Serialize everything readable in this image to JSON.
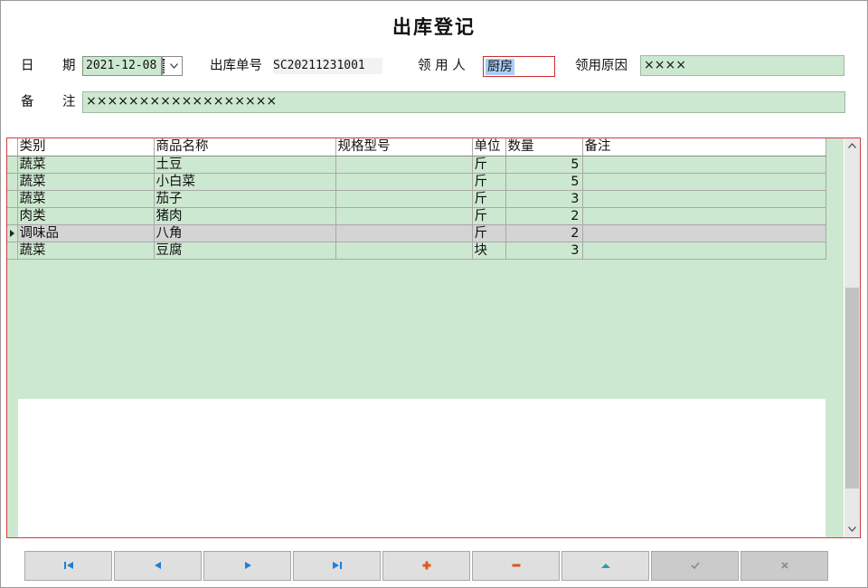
{
  "window": {
    "title": "出库登记"
  },
  "form": {
    "date_label_1": "日",
    "date_label_2": "期",
    "date_value": "2021-12-08",
    "order_label": "出库单号",
    "order_value": "SC20211231001",
    "receiver_label": "领 用 人",
    "receiver_value": "厨房",
    "reason_label": "领用原因",
    "reason_value": "××××",
    "remark_label_1": "备",
    "remark_label_2": "注",
    "remark_value": "××××××××××××××××××"
  },
  "grid": {
    "columns": [
      "类别",
      "商品名称",
      "规格型号",
      "单位",
      "数量",
      "备注"
    ],
    "rows": [
      {
        "category": "蔬菜",
        "name": "土豆",
        "spec": "",
        "unit": "斤",
        "qty": "5",
        "note": ""
      },
      {
        "category": "蔬菜",
        "name": "小白菜",
        "spec": "",
        "unit": "斤",
        "qty": "5",
        "note": ""
      },
      {
        "category": "蔬菜",
        "name": "茄子",
        "spec": "",
        "unit": "斤",
        "qty": "3",
        "note": ""
      },
      {
        "category": "肉类",
        "name": "猪肉",
        "spec": "",
        "unit": "斤",
        "qty": "2",
        "note": ""
      },
      {
        "category": "调味品",
        "name": "八角",
        "spec": "",
        "unit": "斤",
        "qty": "2",
        "note": ""
      },
      {
        "category": "蔬菜",
        "name": "豆腐",
        "spec": "",
        "unit": "块",
        "qty": "3",
        "note": ""
      }
    ],
    "selected_row": 4
  },
  "toolbar": {
    "buttons": [
      "first-record",
      "previous-record",
      "next-record",
      "last-record",
      "add-record",
      "delete-record",
      "edit-record",
      "save-record",
      "cancel-record"
    ]
  },
  "colors": {
    "field_green": "#cde8d0",
    "focus_border": "#d02b2b",
    "nav_blue": "#1f7fd6",
    "action_orange": "#e0561b",
    "edit_teal": "#2a9bb8"
  }
}
